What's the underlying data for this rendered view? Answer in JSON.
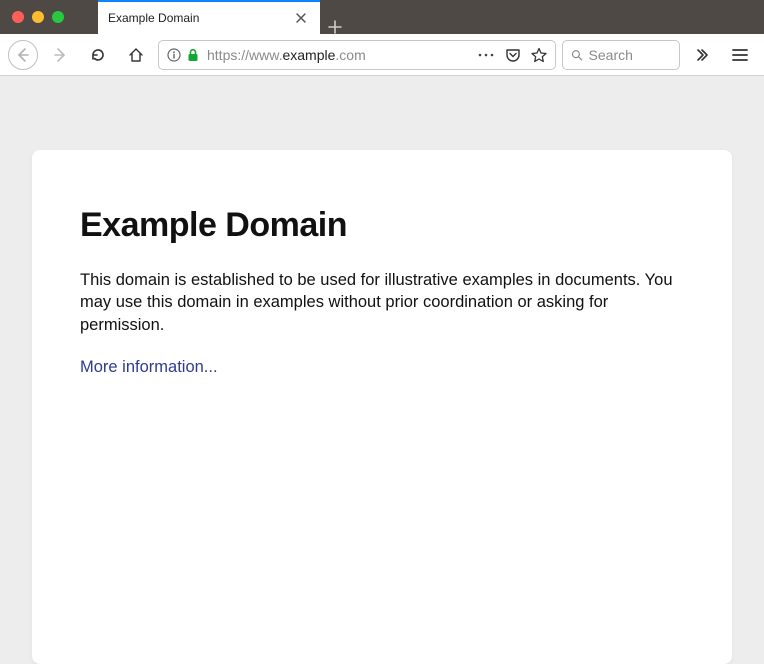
{
  "tab": {
    "title": "Example Domain"
  },
  "url": {
    "prefix": "https://www.",
    "host": "example",
    "suffix": ".com"
  },
  "search": {
    "placeholder": "Search"
  },
  "page": {
    "heading": "Example Domain",
    "body": "This domain is established to be used for illustrative examples in documents. You may use this domain in examples without prior coordination or asking for permission.",
    "link_text": "More information..."
  }
}
